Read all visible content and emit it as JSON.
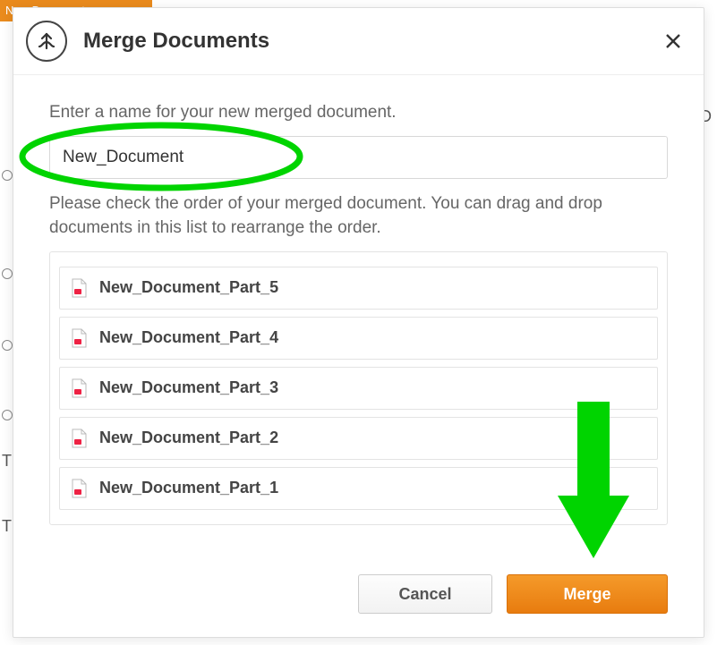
{
  "background": {
    "top_button_1": "New Document",
    "right_letter": "D"
  },
  "modal": {
    "title": "Merge Documents",
    "name_instruction": "Enter a name for your new merged document.",
    "name_value": "New_Document",
    "order_instruction": "Please check the order of your merged document. You can drag and drop documents in this list to rearrange the order.",
    "documents": [
      {
        "name": "New_Document_Part_5"
      },
      {
        "name": "New_Document_Part_4"
      },
      {
        "name": "New_Document_Part_3"
      },
      {
        "name": "New_Document_Part_2"
      },
      {
        "name": "New_Document_Part_1"
      }
    ],
    "cancel_label": "Cancel",
    "merge_label": "Merge"
  },
  "colors": {
    "accent": "#e87c0f",
    "annotation": "#00d400"
  }
}
